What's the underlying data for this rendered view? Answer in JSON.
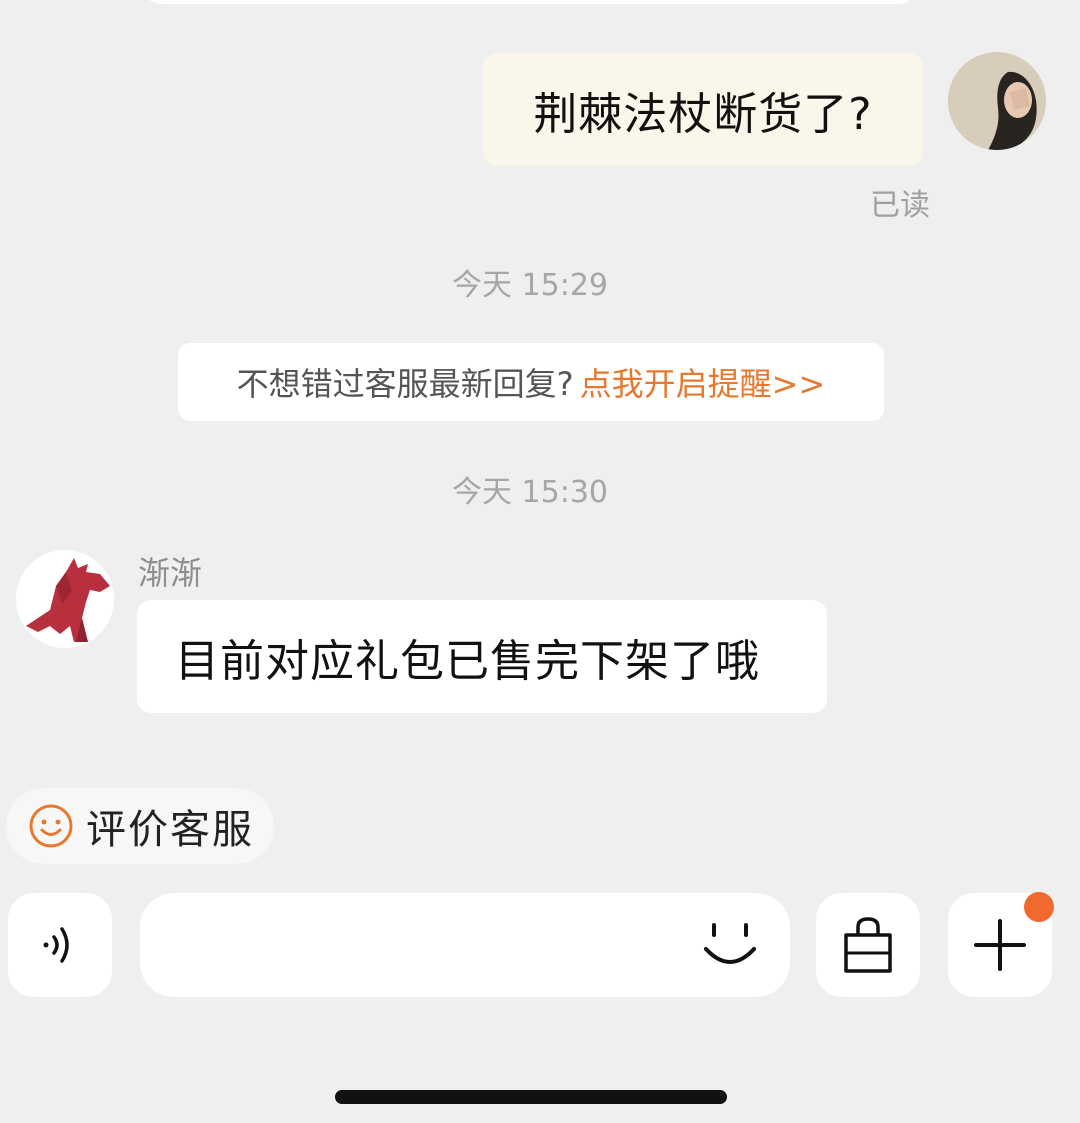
{
  "messages": {
    "outgoing": {
      "text": "荆棘法杖断货了?",
      "status": "已读"
    },
    "timestamp_1": "今天 15:29",
    "notice": {
      "text": "不想错过客服最新回复?",
      "link": "点我开启提醒>>"
    },
    "timestamp_2": "今天 15:30",
    "incoming": {
      "sender": "渐渐",
      "text": "目前对应礼包已售完下架了哦"
    }
  },
  "quick_actions": {
    "rate_label": "评价客服"
  },
  "composer": {
    "placeholder": ""
  },
  "colors": {
    "background": "#efefef",
    "accent_orange": "#e8782d",
    "badge_dot": "#f06a2f",
    "outgoing_bubble": "#fbf6ea"
  },
  "icons": [
    "voice-icon",
    "smile-icon",
    "shopping-bag-icon",
    "plus-icon",
    "rate-smile-icon"
  ]
}
